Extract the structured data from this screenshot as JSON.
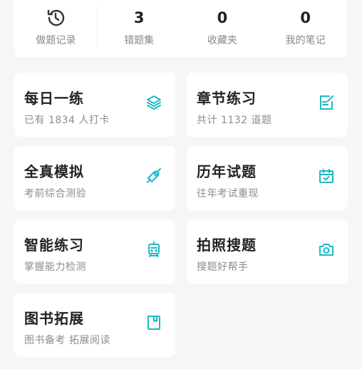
{
  "stats": [
    {
      "value": "",
      "label": "做题记录",
      "icon": "history-icon"
    },
    {
      "value": "3",
      "label": "错题集"
    },
    {
      "value": "0",
      "label": "收藏夹"
    },
    {
      "value": "0",
      "label": "我的笔记"
    }
  ],
  "tiles": [
    {
      "title": "每日一练",
      "sub": "已有 1834 人打卡",
      "icon": "layers-icon"
    },
    {
      "title": "章节练习",
      "sub": "共计 1132 道题",
      "icon": "edit-note-icon"
    },
    {
      "title": "全真模拟",
      "sub": "考前综合测验",
      "icon": "diploma-icon"
    },
    {
      "title": "历年试题",
      "sub": "往年考试重现",
      "icon": "calendar-check-icon"
    },
    {
      "title": "智能练习",
      "sub": "掌握能力检测",
      "icon": "robot-icon"
    },
    {
      "title": "拍照搜题",
      "sub": "搜题好帮手",
      "icon": "camera-icon"
    },
    {
      "title": "图书拓展",
      "sub": "图书备考 拓展阅读",
      "icon": "book-icon"
    }
  ],
  "colors": {
    "accent": "#1fb8c4",
    "background": "#f5f6f8",
    "card": "#ffffff"
  }
}
